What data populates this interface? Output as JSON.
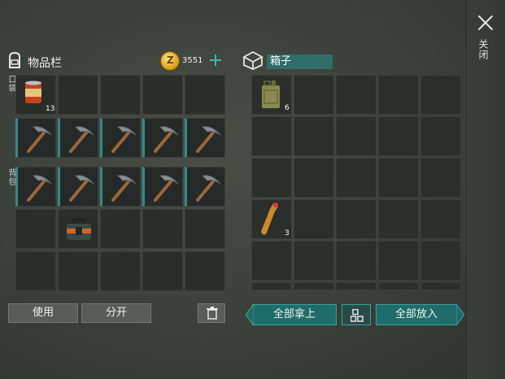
{
  "inventory": {
    "title": "物品栏",
    "coins": "3551",
    "coin_symbol": "Z",
    "pocket_label": "口袋",
    "backpack_label": "背包",
    "pocket_item": {
      "name": "canned-food",
      "count": "13"
    },
    "actions": {
      "use": "使用",
      "split": "分开"
    }
  },
  "box": {
    "title": "箱子",
    "fuel_count": "6",
    "bottle_count": "3",
    "take_all": "全部拿上",
    "put_all": "全部放入"
  },
  "close_label": "关闭",
  "colors": {
    "accent_teal": "#2f8c88",
    "coin_gold": "#d79a12"
  }
}
